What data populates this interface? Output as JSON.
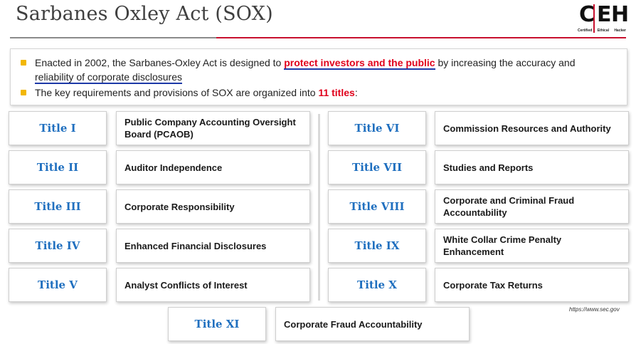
{
  "slide": {
    "title": "Sarbanes Oxley Act (SOX)",
    "source": "https://www.sec.gov"
  },
  "logo": {
    "letters": [
      "C",
      "E",
      "H"
    ],
    "subtitle": [
      "Certified",
      "Ethical",
      "Hacker"
    ]
  },
  "bullets": {
    "b1_pre": "Enacted in 2002, the Sarbanes-Oxley Act is designed to ",
    "b1_highlight": "protect investors and the public",
    "b1_mid": " by increasing the accuracy and ",
    "b1_underline": "reliability of corporate disclosures",
    "b2_pre": "The key requirements and provisions of SOX are organized into ",
    "b2_highlight": "11 titles",
    "b2_post": ":"
  },
  "titles": [
    {
      "label": "Title I",
      "desc": "Public Company Accounting Oversight Board (PCAOB)"
    },
    {
      "label": "Title II",
      "desc": "Auditor Independence"
    },
    {
      "label": "Title III",
      "desc": "Corporate Responsibility"
    },
    {
      "label": "Title IV",
      "desc": "Enhanced Financial Disclosures"
    },
    {
      "label": "Title V",
      "desc": "Analyst Conflicts of Interest"
    },
    {
      "label": "Title VI",
      "desc": "Commission Resources and Authority"
    },
    {
      "label": "Title VII",
      "desc": "Studies and Reports"
    },
    {
      "label": "Title VIII",
      "desc": "Corporate and Criminal Fraud Accountability"
    },
    {
      "label": "Title IX",
      "desc": "White Collar Crime Penalty Enhancement"
    },
    {
      "label": "Title X",
      "desc": "Corporate Tax Returns"
    },
    {
      "label": "Title XI",
      "desc": "Corporate Fraud Accountability"
    }
  ],
  "colors": {
    "accent_red": "#c8102e",
    "title_blue": "#1f6fbf",
    "bullet_yellow": "#f2b705",
    "underline_blue": "#1e3aa8"
  }
}
